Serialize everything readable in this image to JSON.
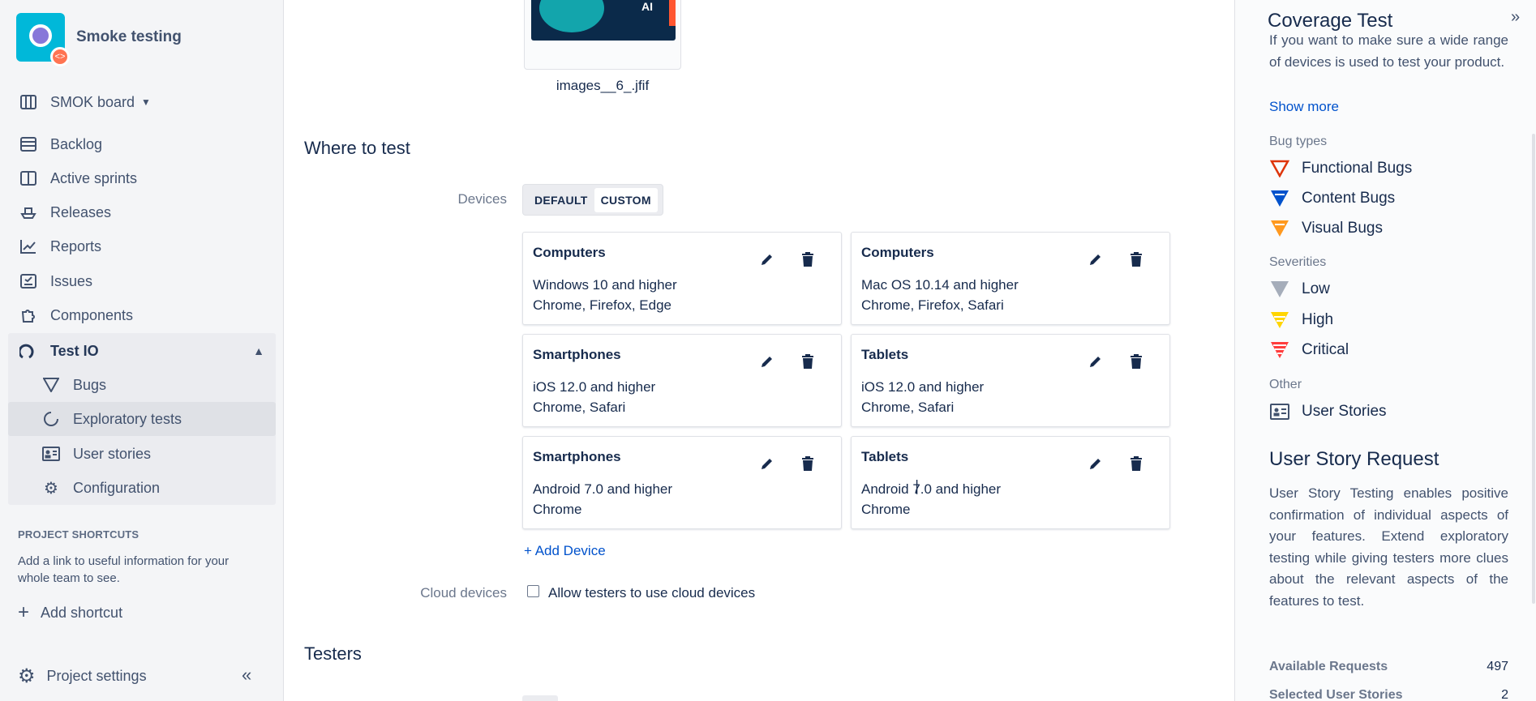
{
  "project": {
    "name": "Smoke testing"
  },
  "sidebar": {
    "board_label": "SMOK board",
    "items": [
      {
        "label": "Backlog",
        "icon": "backlog-icon"
      },
      {
        "label": "Active sprints",
        "icon": "board-icon"
      },
      {
        "label": "Releases",
        "icon": "ship-icon"
      },
      {
        "label": "Reports",
        "icon": "chart-icon"
      },
      {
        "label": "Issues",
        "icon": "issues-icon"
      },
      {
        "label": "Components",
        "icon": "puzzle-icon"
      }
    ],
    "testio": {
      "label": "Test IO",
      "children": [
        {
          "label": "Bugs",
          "icon": "bug-triangle-icon"
        },
        {
          "label": "Exploratory tests",
          "icon": "spinner-icon",
          "selected": true
        },
        {
          "label": "User stories",
          "icon": "user-card-icon"
        },
        {
          "label": "Configuration",
          "icon": "gear-icon"
        }
      ]
    },
    "shortcuts_title": "PROJECT SHORTCUTS",
    "shortcuts_desc": "Add a link to useful information for your whole team to see.",
    "add_shortcut": "Add shortcut",
    "project_settings": "Project settings"
  },
  "main": {
    "image_caption": "images__6_.jfif",
    "image_text": "AI",
    "where_title": "Where to test",
    "devices_label": "Devices",
    "toggle": {
      "default": "DEFAULT",
      "custom": "CUSTOM",
      "active": "custom"
    },
    "devices": [
      {
        "type": "Computers",
        "os": "Windows 10 and higher",
        "browsers": "Chrome, Firefox, Edge"
      },
      {
        "type": "Computers",
        "os": "Mac OS 10.14 and higher",
        "browsers": "Chrome, Firefox, Safari"
      },
      {
        "type": "Smartphones",
        "os": "iOS 12.0 and higher",
        "browsers": "Chrome, Safari"
      },
      {
        "type": "Tablets",
        "os": "iOS 12.0 and higher",
        "browsers": "Chrome, Safari"
      },
      {
        "type": "Smartphones",
        "os": "Android 7.0 and higher",
        "browsers": "Chrome"
      },
      {
        "type": "Tablets",
        "os": "Android 7.0 and higher",
        "browsers": "Chrome"
      }
    ],
    "add_device": "+ Add Device",
    "cloud_label": "Cloud devices",
    "cloud_text": "Allow testers to use cloud devices",
    "testers_title": "Testers"
  },
  "panel": {
    "title": "Coverage Test",
    "intro": "If you want to make sure a wide range of devices is used to test your product.",
    "show_more": "Show more",
    "bug_types_head": "Bug types",
    "bug_types": [
      {
        "label": "Functional Bugs",
        "color": "#de350b"
      },
      {
        "label": "Content Bugs",
        "color": "#0052cc"
      },
      {
        "label": "Visual Bugs",
        "color": "#ff991f"
      }
    ],
    "severities_head": "Severities",
    "severities": [
      {
        "label": "Low",
        "color": "#a5adba"
      },
      {
        "label": "High",
        "color": "#ffd500"
      },
      {
        "label": "Critical",
        "color": "#ff3d3d"
      }
    ],
    "other_head": "Other",
    "other": [
      {
        "label": "User Stories"
      }
    ],
    "usr_title": "User Story Request",
    "usr_text": "User Story Testing enables positive confirmation of individual aspects of your features. Extend exploratory testing while giving testers more clues about the relevant aspects of the features to test.",
    "stats": [
      {
        "label": "Available Requests",
        "value": "497"
      },
      {
        "label": "Selected User Stories",
        "value": "2"
      }
    ]
  }
}
